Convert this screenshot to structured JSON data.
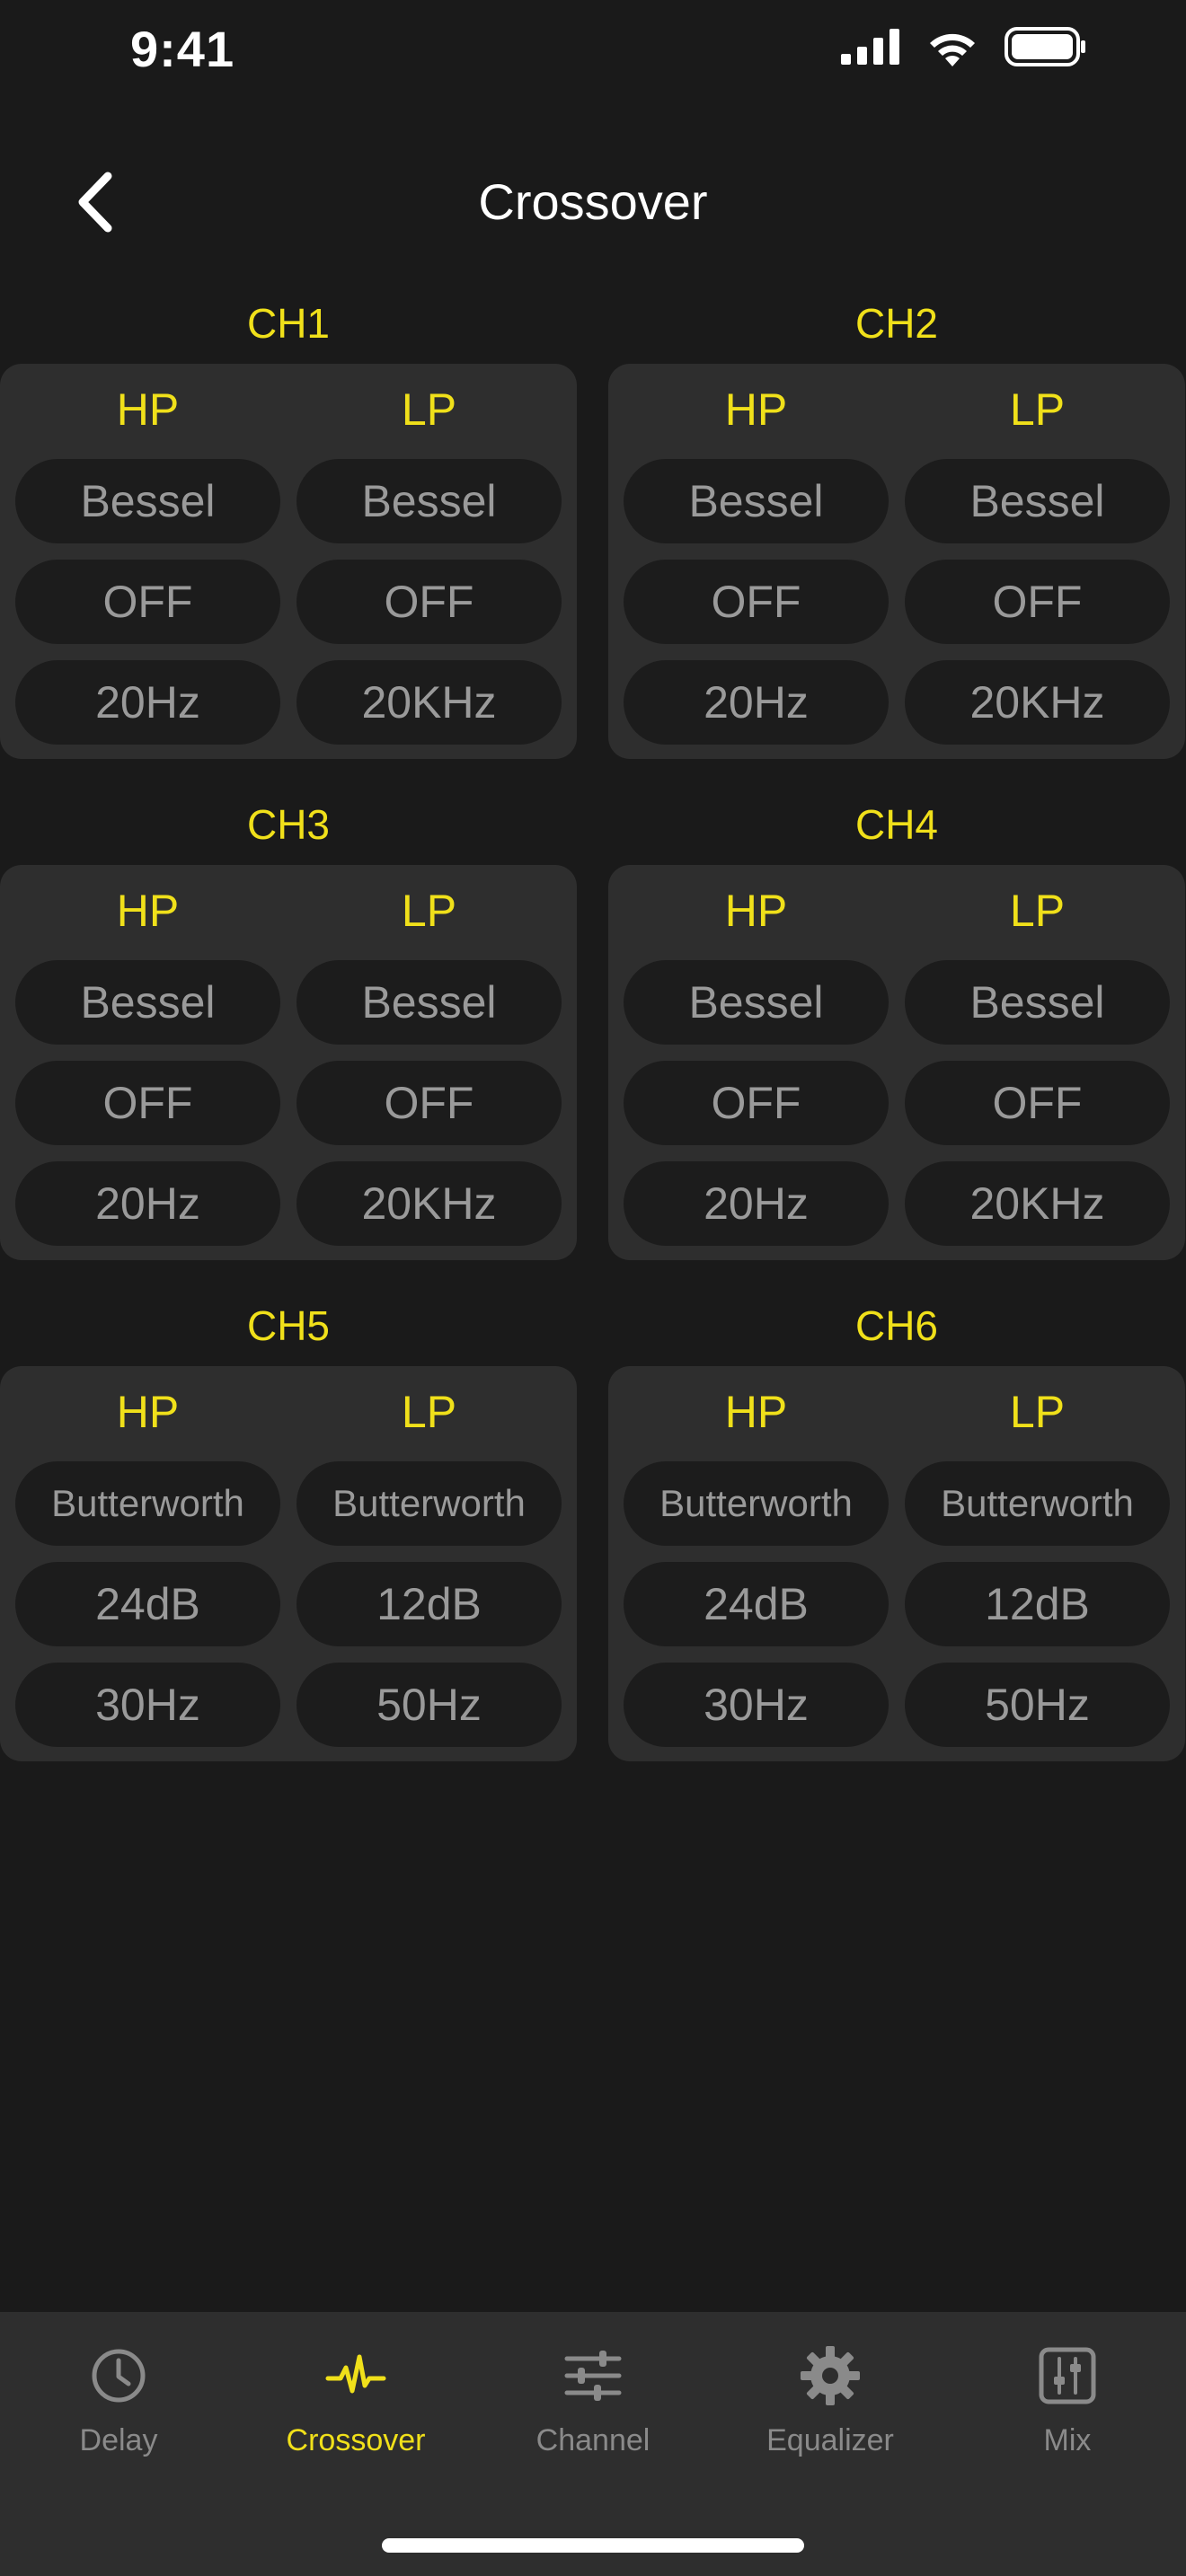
{
  "status_bar": {
    "time": "9:41"
  },
  "nav": {
    "title": "Crossover"
  },
  "channels": [
    {
      "title": "CH1",
      "hp_label": "HP",
      "lp_label": "LP",
      "hp": {
        "type": "Bessel",
        "slope": "OFF",
        "freq": "20Hz"
      },
      "lp": {
        "type": "Bessel",
        "slope": "OFF",
        "freq": "20KHz"
      }
    },
    {
      "title": "CH2",
      "hp_label": "HP",
      "lp_label": "LP",
      "hp": {
        "type": "Bessel",
        "slope": "OFF",
        "freq": "20Hz"
      },
      "lp": {
        "type": "Bessel",
        "slope": "OFF",
        "freq": "20KHz"
      }
    },
    {
      "title": "CH3",
      "hp_label": "HP",
      "lp_label": "LP",
      "hp": {
        "type": "Bessel",
        "slope": "OFF",
        "freq": "20Hz"
      },
      "lp": {
        "type": "Bessel",
        "slope": "OFF",
        "freq": "20KHz"
      }
    },
    {
      "title": "CH4",
      "hp_label": "HP",
      "lp_label": "LP",
      "hp": {
        "type": "Bessel",
        "slope": "OFF",
        "freq": "20Hz"
      },
      "lp": {
        "type": "Bessel",
        "slope": "OFF",
        "freq": "20KHz"
      }
    },
    {
      "title": "CH5",
      "hp_label": "HP",
      "lp_label": "LP",
      "hp": {
        "type": "Butterworth",
        "slope": "24dB",
        "freq": "30Hz"
      },
      "lp": {
        "type": "Butterworth",
        "slope": "12dB",
        "freq": "50Hz"
      }
    },
    {
      "title": "CH6",
      "hp_label": "HP",
      "lp_label": "LP",
      "hp": {
        "type": "Butterworth",
        "slope": "24dB",
        "freq": "30Hz"
      },
      "lp": {
        "type": "Butterworth",
        "slope": "12dB",
        "freq": "50Hz"
      }
    }
  ],
  "tabs": [
    {
      "label": "Delay",
      "icon": "clock-icon",
      "active": false
    },
    {
      "label": "Crossover",
      "icon": "waveform-icon",
      "active": true
    },
    {
      "label": "Channel",
      "icon": "sliders-icon",
      "active": false
    },
    {
      "label": "Equalizer",
      "icon": "gear-icon",
      "active": false
    },
    {
      "label": "Mix",
      "icon": "mixer-icon",
      "active": false
    }
  ],
  "colors": {
    "background": "#1a1a1a",
    "panel": "#2e2e2e",
    "pill": "#1c1c1c",
    "accent": "#f0e01a",
    "muted_text": "#9a9a9a"
  }
}
